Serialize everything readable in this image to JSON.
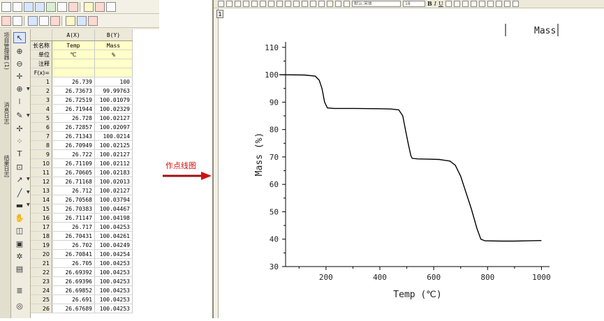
{
  "worksheet": {
    "columns": [
      {
        "header": "A(X)",
        "long_name": "Temp",
        "units": "℃",
        "comments": ""
      },
      {
        "header": "B(Y)",
        "long_name": "Mass",
        "units": "%",
        "comments": ""
      }
    ],
    "row_labels": {
      "long_name": "长名称",
      "units": "单位",
      "comments": "注释",
      "fx": "F(x)="
    },
    "rows": [
      [
        "1",
        "26.739",
        "100"
      ],
      [
        "2",
        "26.73673",
        "99.99763"
      ],
      [
        "3",
        "26.72519",
        "100.01079"
      ],
      [
        "4",
        "26.71944",
        "100.02329"
      ],
      [
        "5",
        "26.728",
        "100.02127"
      ],
      [
        "6",
        "26.72857",
        "100.02097"
      ],
      [
        "7",
        "26.71343",
        "100.0214"
      ],
      [
        "8",
        "26.70949",
        "100.02125"
      ],
      [
        "9",
        "26.722",
        "100.02127"
      ],
      [
        "10",
        "26.71109",
        "100.02112"
      ],
      [
        "11",
        "26.70605",
        "100.02183"
      ],
      [
        "12",
        "26.71168",
        "100.02013"
      ],
      [
        "13",
        "26.712",
        "100.02127"
      ],
      [
        "14",
        "26.70568",
        "100.03794"
      ],
      [
        "15",
        "26.70383",
        "100.04467"
      ],
      [
        "16",
        "26.71147",
        "100.04198"
      ],
      [
        "17",
        "26.717",
        "100.04253"
      ],
      [
        "18",
        "26.70431",
        "100.04261"
      ],
      [
        "19",
        "26.702",
        "100.04249"
      ],
      [
        "20",
        "26.70841",
        "100.04254"
      ],
      [
        "21",
        "26.705",
        "100.04253"
      ],
      [
        "22",
        "26.69392",
        "100.04253"
      ],
      [
        "23",
        "26.69396",
        "100.04253"
      ],
      [
        "24",
        "26.69852",
        "100.04253"
      ],
      [
        "25",
        "26.691",
        "100.04253"
      ],
      [
        "26",
        "26.67689",
        "100.04253"
      ]
    ]
  },
  "left_panel": {
    "tabs": [
      "项目管理器 (1)",
      "消息日志",
      "结果日志"
    ]
  },
  "annotation": {
    "label": "作点线图",
    "color": "#d01010"
  },
  "plot_window": {
    "layer_number": "1",
    "toolbar": {
      "font_name": "默认:宋体",
      "font_size": "18",
      "bold": "B",
      "italic": "I",
      "underline": "U"
    }
  },
  "chart_data": {
    "type": "line",
    "xlabel": "Temp (℃)",
    "ylabel": "Mass (%)",
    "legend": "Mass",
    "legend_position": "top-right",
    "xlim": [
      50,
      1030
    ],
    "ylim": [
      30,
      112
    ],
    "xticks": [
      200,
      400,
      600,
      800,
      1000
    ],
    "yticks": [
      30,
      40,
      50,
      60,
      70,
      80,
      90,
      100,
      110
    ],
    "grid": false,
    "line_color": "#000000",
    "series": [
      {
        "name": "Mass",
        "x": [
          27,
          120,
          160,
          175,
          185,
          195,
          205,
          230,
          300,
          400,
          440,
          470,
          485,
          495,
          505,
          515,
          520,
          540,
          580,
          620,
          660,
          680,
          700,
          720,
          740,
          760,
          775,
          790,
          850,
          900,
          950,
          1000
        ],
        "y": [
          100,
          99.9,
          99.5,
          98,
          95,
          90,
          87.9,
          87.7,
          87.7,
          87.6,
          87.5,
          87.2,
          85,
          80,
          75,
          70.5,
          69.5,
          69.3,
          69.2,
          69.1,
          68.5,
          67,
          63,
          57,
          51,
          44,
          40,
          39.4,
          39.3,
          39.3,
          39.4,
          39.5
        ]
      }
    ]
  }
}
